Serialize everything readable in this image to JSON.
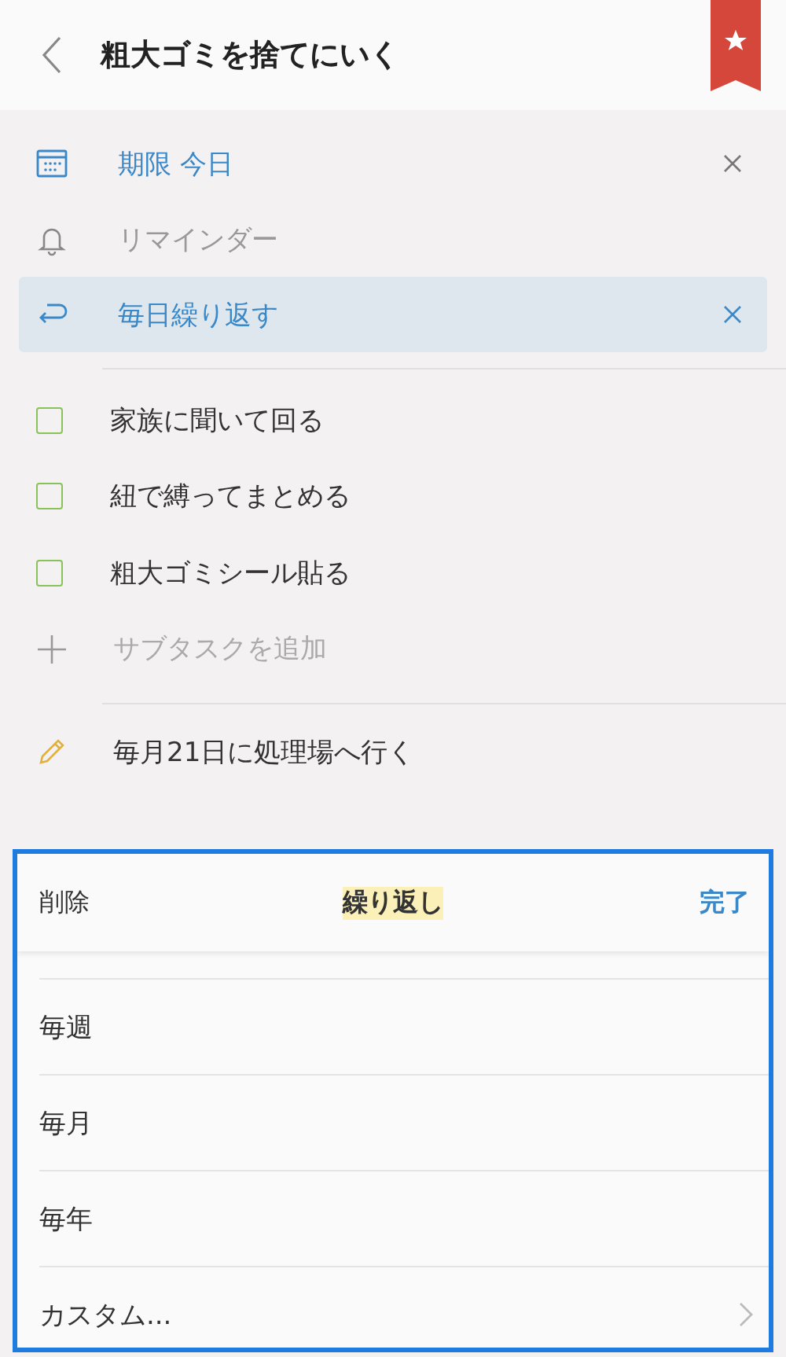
{
  "header": {
    "title": "粗大ゴミを捨てにいく",
    "starred": true
  },
  "attributes": [
    {
      "kind": "due",
      "label": "期限 今日",
      "set": true,
      "selected": false
    },
    {
      "kind": "reminder",
      "label": "リマインダー",
      "set": false,
      "selected": false
    },
    {
      "kind": "repeat",
      "label": "毎日繰り返す",
      "set": true,
      "selected": true
    }
  ],
  "subtasks": [
    {
      "label": "家族に聞いて回る",
      "checked": false
    },
    {
      "label": "紐で縛ってまとめる",
      "checked": false
    },
    {
      "label": "粗大ゴミシール貼る",
      "checked": false
    }
  ],
  "add_subtask": {
    "placeholder": "サブタスクを追加"
  },
  "note": "毎月21日に処理場へ行く",
  "sheet": {
    "delete": "削除",
    "title": "繰り返し",
    "done": "完了",
    "options": [
      {
        "label": "毎週",
        "has_arrow": false
      },
      {
        "label": "毎月",
        "has_arrow": false
      },
      {
        "label": "毎年",
        "has_arrow": false
      },
      {
        "label": "カスタム...",
        "has_arrow": true
      }
    ]
  }
}
